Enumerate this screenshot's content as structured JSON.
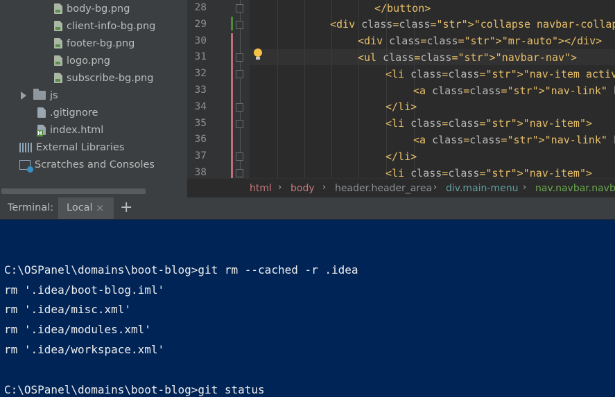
{
  "project_tree": {
    "items": [
      {
        "label": "body-bg.png"
      },
      {
        "label": "client-info-bg.png"
      },
      {
        "label": "footer-bg.png"
      },
      {
        "label": "logo.png"
      },
      {
        "label": "subscribe-bg.png"
      },
      {
        "label": "js"
      },
      {
        "label": ".gitignore"
      },
      {
        "label": "index.html"
      },
      {
        "label": "External Libraries"
      },
      {
        "label": "Scratches and Consoles"
      }
    ]
  },
  "editor": {
    "line_numbers": [
      "28",
      "29",
      "30",
      "31",
      "32",
      "33",
      "34",
      "35",
      "36",
      "37",
      "38"
    ],
    "code": [
      "</button>",
      "<div class=\"collapse navbar-collapse\" id=",
      "<div class=\"mr-auto\"></div>",
      "<ul class=\"navbar-nav\">",
      "<li class=\"nav-item active\">",
      "<a class=\"nav-link\" href=\"#\">",
      "</li>",
      "<li class=\"nav-item\">",
      "<a class=\"nav-link\" href=\"#\">",
      "</li>",
      "<li class=\"nav-item\">"
    ]
  },
  "breadcrumb": [
    "html",
    "body",
    "header.header_area",
    "div.main-menu",
    "nav.navbar.navbar"
  ],
  "breadcrumb_colors": [
    "#c6777b",
    "#c6777b",
    "#8b8f94",
    "#5f9ea0",
    "#6aa84f"
  ],
  "terminal": {
    "title": "Terminal:",
    "tab": "Local",
    "close_icon": "×",
    "add_icon": "+",
    "lines": [
      "",
      "C:\\OSPanel\\domains\\boot-blog>git rm --cached -r .idea",
      "rm '.idea/boot-blog.iml'",
      "rm '.idea/misc.xml'",
      "rm '.idea/modules.xml'",
      "rm '.idea/workspace.xml'",
      "",
      "C:\\OSPanel\\domains\\boot-blog>git status"
    ]
  }
}
